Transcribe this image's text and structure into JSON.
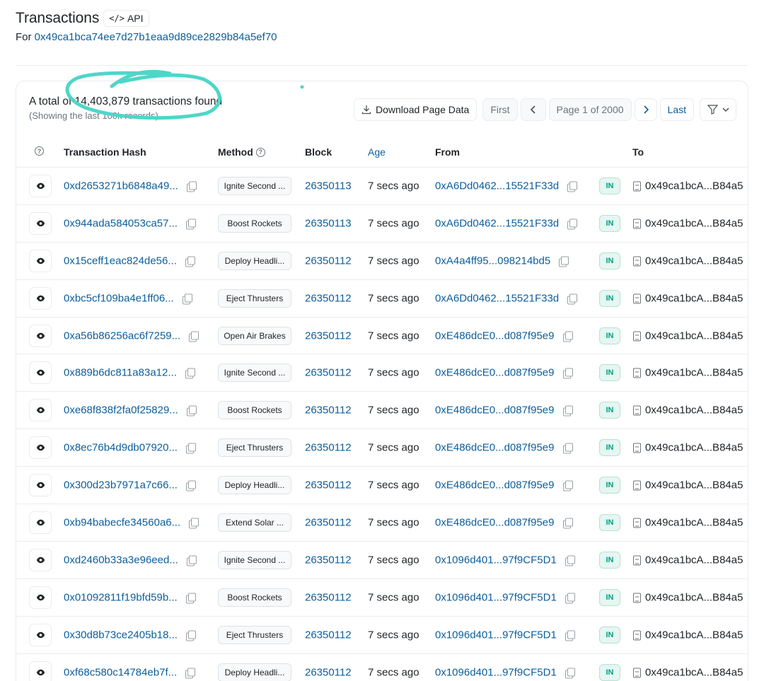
{
  "header": {
    "title": "Transactions",
    "api_label": "API",
    "for_label": "For",
    "address": "0x49ca1bca74ee7d27b1eaa9d89ce2829b84a5ef70"
  },
  "summary": {
    "total": "A total of 14,403,879 transactions found",
    "showing": "(Showing the last 100k records)"
  },
  "toolbar": {
    "download_label": "Download Page Data",
    "first_label": "First",
    "page_label": "Page 1 of 2000",
    "last_label": "Last"
  },
  "columns": {
    "hash": "Transaction Hash",
    "method": "Method",
    "block": "Block",
    "age": "Age",
    "from": "From",
    "to": "To"
  },
  "rows": [
    {
      "hash": "0xd2653271b6848a49...",
      "method": "Ignite Second ...",
      "block": "26350113",
      "age": "7 secs ago",
      "from": "0xA6Dd0462...15521F33d",
      "direction": "IN",
      "to": "0x49ca1bcA...B84a5"
    },
    {
      "hash": "0x944ada584053ca57...",
      "method": "Boost Rockets",
      "block": "26350113",
      "age": "7 secs ago",
      "from": "0xA6Dd0462...15521F33d",
      "direction": "IN",
      "to": "0x49ca1bcA...B84a5"
    },
    {
      "hash": "0x15ceff1eac824de56...",
      "method": "Deploy Headli...",
      "block": "26350112",
      "age": "7 secs ago",
      "from": "0xA4a4ff95...098214bd5",
      "direction": "IN",
      "to": "0x49ca1bcA...B84a5"
    },
    {
      "hash": "0xbc5cf109ba4e1ff06...",
      "method": "Eject Thrusters",
      "block": "26350112",
      "age": "7 secs ago",
      "from": "0xA6Dd0462...15521F33d",
      "direction": "IN",
      "to": "0x49ca1bcA...B84a5"
    },
    {
      "hash": "0xa56b86256ac6f7259...",
      "method": "Open Air Brakes",
      "block": "26350112",
      "age": "7 secs ago",
      "from": "0xE486dcE0...d087f95e9",
      "direction": "IN",
      "to": "0x49ca1bcA...B84a5"
    },
    {
      "hash": "0x889b6dc811a83a12...",
      "method": "Ignite Second ...",
      "block": "26350112",
      "age": "7 secs ago",
      "from": "0xE486dcE0...d087f95e9",
      "direction": "IN",
      "to": "0x49ca1bcA...B84a5"
    },
    {
      "hash": "0xe68f838f2fa0f25829...",
      "method": "Boost Rockets",
      "block": "26350112",
      "age": "7 secs ago",
      "from": "0xE486dcE0...d087f95e9",
      "direction": "IN",
      "to": "0x49ca1bcA...B84a5"
    },
    {
      "hash": "0x8ec76b4d9db07920...",
      "method": "Eject Thrusters",
      "block": "26350112",
      "age": "7 secs ago",
      "from": "0xE486dcE0...d087f95e9",
      "direction": "IN",
      "to": "0x49ca1bcA...B84a5"
    },
    {
      "hash": "0x300d23b7971a7c66...",
      "method": "Deploy Headli...",
      "block": "26350112",
      "age": "7 secs ago",
      "from": "0xE486dcE0...d087f95e9",
      "direction": "IN",
      "to": "0x49ca1bcA...B84a5"
    },
    {
      "hash": "0xb94babecfe34560a6...",
      "method": "Extend Solar ...",
      "block": "26350112",
      "age": "7 secs ago",
      "from": "0xE486dcE0...d087f95e9",
      "direction": "IN",
      "to": "0x49ca1bcA...B84a5"
    },
    {
      "hash": "0xd2460b33a3e96eed...",
      "method": "Ignite Second ...",
      "block": "26350112",
      "age": "7 secs ago",
      "from": "0x1096d401...97f9CF5D1",
      "direction": "IN",
      "to": "0x49ca1bcA...B84a5"
    },
    {
      "hash": "0x01092811f19bfd59b...",
      "method": "Boost Rockets",
      "block": "26350112",
      "age": "7 secs ago",
      "from": "0x1096d401...97f9CF5D1",
      "direction": "IN",
      "to": "0x49ca1bcA...B84a5"
    },
    {
      "hash": "0x30d8b73ce2405b18...",
      "method": "Eject Thrusters",
      "block": "26350112",
      "age": "7 secs ago",
      "from": "0x1096d401...97f9CF5D1",
      "direction": "IN",
      "to": "0x49ca1bcA...B84a5"
    },
    {
      "hash": "0xf68c580c14784eb7f...",
      "method": "Deploy Headli...",
      "block": "26350112",
      "age": "7 secs ago",
      "from": "0x1096d401...97f9CF5D1",
      "direction": "IN",
      "to": "0x49ca1bcA...B84a5"
    }
  ],
  "colors": {
    "link": "#0b5e9c",
    "in_badge": "#00a186",
    "annotation": "#4fd6c8"
  }
}
